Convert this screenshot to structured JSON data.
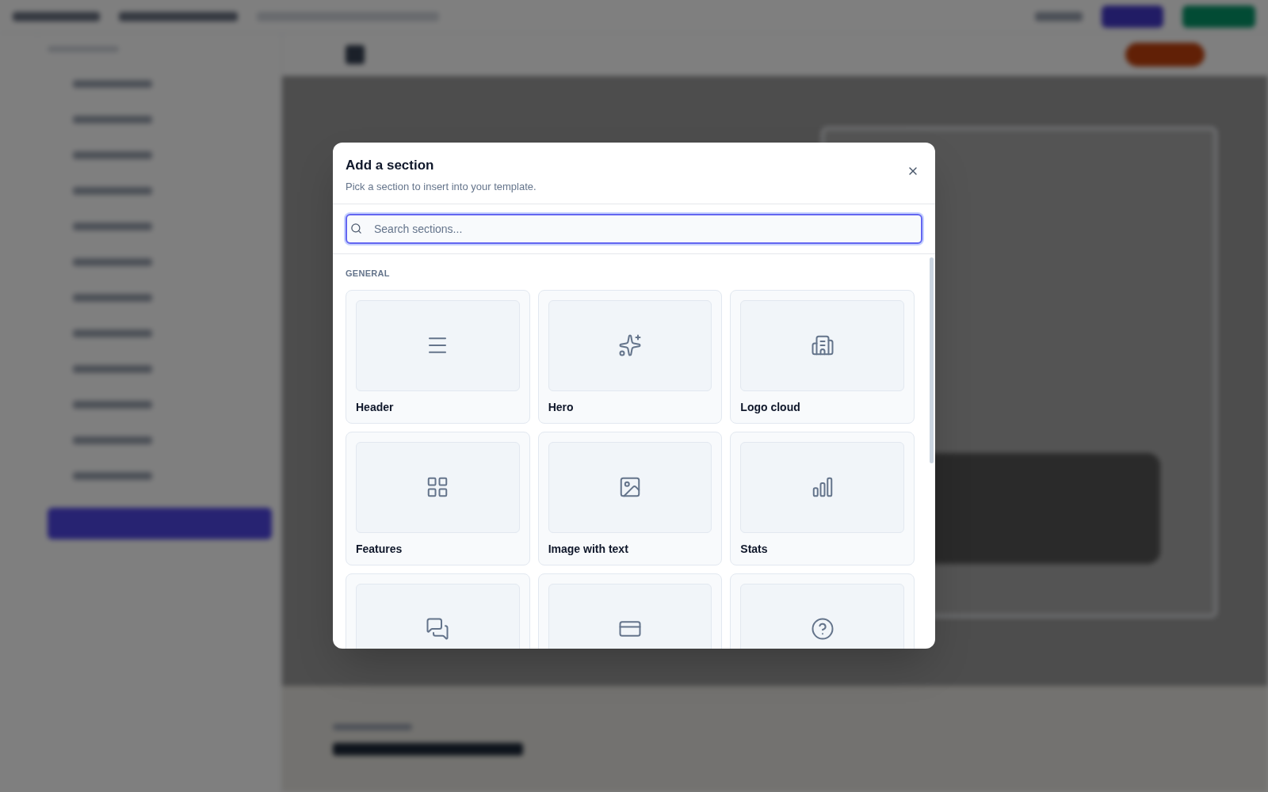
{
  "dialog": {
    "title": "Add a section",
    "subtitle": "Pick a section to insert into your template.",
    "search": {
      "placeholder": "Search sections..."
    },
    "group_label": "GENERAL",
    "sections": [
      {
        "kind": "labeled",
        "label": "Header"
      },
      {
        "kind": "labeled",
        "label": "Hero"
      },
      {
        "kind": "labeled",
        "label": "Logo cloud"
      },
      {
        "kind": "labeled",
        "label": "Features"
      },
      {
        "kind": "labeled",
        "label": "Image with text"
      },
      {
        "kind": "labeled",
        "label": "Stats"
      },
      {
        "kind": "preview_only"
      },
      {
        "kind": "preview_only"
      },
      {
        "kind": "preview_only"
      }
    ]
  }
}
